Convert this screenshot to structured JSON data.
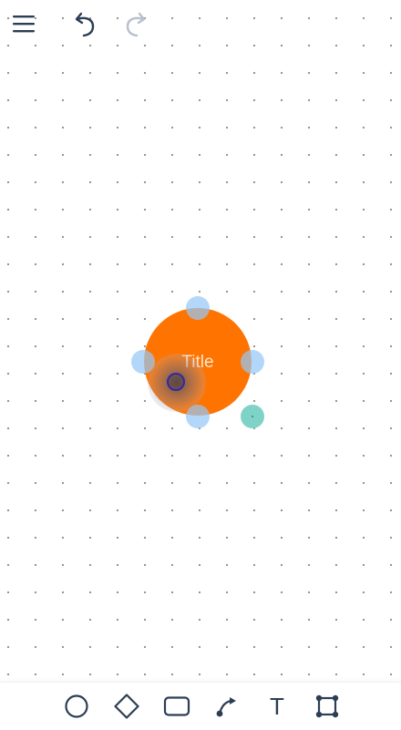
{
  "canvas": {
    "grid": "dotted"
  },
  "topbar": {
    "menu_icon": "hamburger-menu-icon",
    "undo_icon": "undo-icon",
    "redo_icon": "redo-icon",
    "redo_enabled": false
  },
  "node": {
    "shape": "circle",
    "title": "Title",
    "fill_color": "#ff7300",
    "title_color": "#ffe8d2",
    "selected": true
  },
  "handles": {
    "resize_color": "#96c8f5",
    "link_color": "#7fd3c6"
  },
  "toolbar": {
    "tools": [
      {
        "icon": "circle-icon"
      },
      {
        "icon": "diamond-icon"
      },
      {
        "icon": "rectangle-icon"
      },
      {
        "icon": "connector-icon"
      },
      {
        "icon": "text-icon",
        "glyph": "T"
      },
      {
        "icon": "frame-icon"
      }
    ]
  },
  "colors": {
    "icon": "#2c3e54",
    "icon_disabled": "#b8c0cc"
  }
}
